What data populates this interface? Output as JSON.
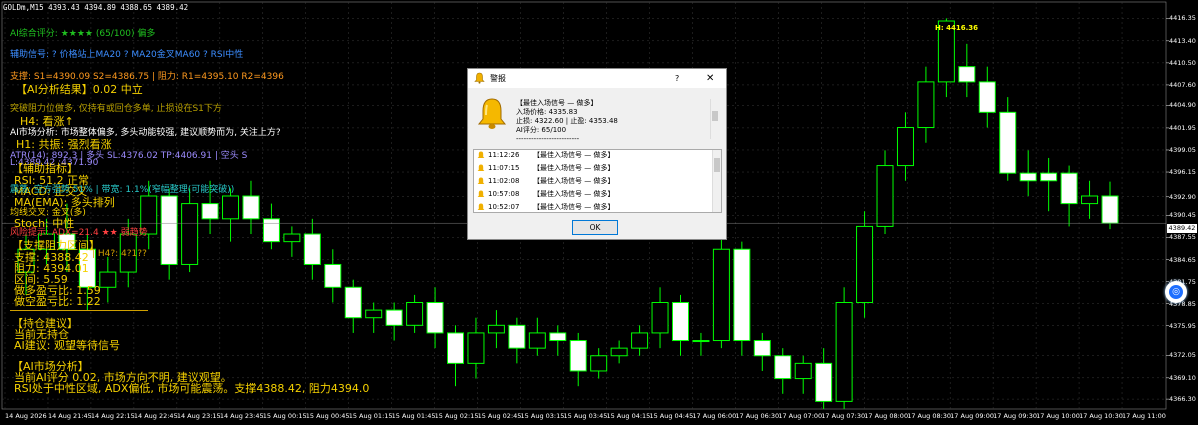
{
  "header": {
    "symbol_line": "GOLDm,M15  4393.43 4394.89 4388.65 4389.42"
  },
  "colors": {
    "bull": "#00ff00",
    "bear_body": "#ffffff",
    "grid": "#3a3a3a",
    "gold_text": "#f5d100",
    "blue_text": "#3c8dff",
    "orange_text": "#ff9a1f",
    "purple_text": "#9d8cff",
    "cyan_text": "#28c8c8",
    "red_text": "#ff4040",
    "green_text": "#20c020"
  },
  "overlay": {
    "ai_score": "AI综合评分: ★★★★ (65/100) 偏多",
    "aux_signal": "辅助信号: ? 价格站上MA20 ? MA20金叉MA60 ? RSI中性",
    "support_line": "支撑: S1=4390.09 S2=4386.75 | 阻力: R1=4395.10 R2=4396",
    "ai_overview_title": "【AI分析结果】0.02 中立",
    "suggest_line": "突破阻力位做多, 仅持有或回仓多单, 止损设在S1下方",
    "timeframe_h4": "H4: 看涨↑",
    "ai_view": "AI市场分析: 市场整体偏多, 多头动能较强, 建议顺势而为, 关注上方?",
    "h1_status": "H1: 共振: 强烈看涨",
    "atr_line": "ATR(14): 892.3 | 多头 SL:4376.02  TP:4406.91 | 空头 S",
    "l_line": "L:4389.42    :4371.90",
    "aux_title": "【辅助指标】",
    "rsi": "RSI: 51.2 正常",
    "macd": "MACD: 正交叉",
    "macd_extra": "震荡: 空方强势 51% | 带宽: 1.1%(窄幅整理(可能突破))",
    "ma_line": "MA(EMA): 多头排列",
    "ma_extra": "均线交叉: 金叉(多)",
    "stoch": "Stoch: 中性",
    "risk": "风险提示: ADX=21.4 ★★ 弱趋势",
    "sr_title": "【支撑阻力区间】",
    "sr_s": "支撑: 4388.42",
    "sr_s_extra": "| H4?: 4?1??",
    "sr_r": "阻力: 4394.01",
    "sr_range": "区间: 5.59",
    "long_ratio": "做多盈亏比: 1.59",
    "short_ratio": "做空盈亏比: 1.22",
    "pos_title": "【持仓建议】",
    "pos_none": "当前无持仓",
    "pos_ai": "AI建议: 观望等待信号",
    "market_title": "【AI市场分析】",
    "market_l1": "当前AI评分 0.02, 市场方向不明, 建议观望。",
    "market_l2": "RSI处于中性区域, ADX偏低, 市场可能震荡。支撑4388.42, 阻力4394.0"
  },
  "price_axis": {
    "labels": [
      "4416.35",
      "4413.40",
      "4410.50",
      "4407.60",
      "4404.90",
      "4401.95",
      "4399.05",
      "4396.15",
      "4392.90",
      "4390.45",
      "4387.55",
      "4384.65",
      "4381.75",
      "4378.85",
      "4375.95",
      "4372.05",
      "4369.10",
      "4366.30"
    ],
    "current_price": "4389.42",
    "high_marker": "H: 4416.36"
  },
  "time_axis": {
    "labels": [
      "14 Aug 2026",
      "14 Aug 21:45",
      "14 Aug 22:15",
      "14 Aug 22:45",
      "14 Aug 23:15",
      "14 Aug 23:45",
      "15 Aug 00:15",
      "15 Aug 00:45",
      "15 Aug 01:15",
      "15 Aug 01:45",
      "15 Aug 02:15",
      "15 Aug 02:45",
      "15 Aug 03:15",
      "15 Aug 03:45",
      "15 Aug 04:15",
      "15 Aug 04:45",
      "17 Aug 06:00",
      "17 Aug 06:30",
      "17 Aug 07:00",
      "17 Aug 07:30",
      "17 Aug 08:00",
      "17 Aug 08:30",
      "17 Aug 09:00",
      "17 Aug 09:30",
      "17 Aug 10:00",
      "17 Aug 10:30",
      "17 Aug 11:00"
    ]
  },
  "candles": [
    {
      "o": 4383,
      "c": 4386,
      "h": 4388,
      "l": 4380
    },
    {
      "o": 4386,
      "c": 4388,
      "h": 4390,
      "l": 4384
    },
    {
      "o": 4388,
      "c": 4386,
      "h": 4392,
      "l": 4383
    },
    {
      "o": 4386,
      "c": 4381,
      "h": 4388,
      "l": 4378
    },
    {
      "o": 4381,
      "c": 4383,
      "h": 4385,
      "l": 4379
    },
    {
      "o": 4383,
      "c": 4388,
      "h": 4390,
      "l": 4381
    },
    {
      "o": 4388,
      "c": 4393,
      "h": 4395,
      "l": 4386
    },
    {
      "o": 4393,
      "c": 4384,
      "h": 4394,
      "l": 4382
    },
    {
      "o": 4384,
      "c": 4392,
      "h": 4394,
      "l": 4383
    },
    {
      "o": 4392,
      "c": 4390,
      "h": 4395,
      "l": 4388
    },
    {
      "o": 4390,
      "c": 4393,
      "h": 4394,
      "l": 4387
    },
    {
      "o": 4393,
      "c": 4390,
      "h": 4395,
      "l": 4388
    },
    {
      "o": 4390,
      "c": 4387,
      "h": 4392,
      "l": 4386
    },
    {
      "o": 4387,
      "c": 4388,
      "h": 4389,
      "l": 4385
    },
    {
      "o": 4388,
      "c": 4384,
      "h": 4390,
      "l": 4382
    },
    {
      "o": 4384,
      "c": 4381,
      "h": 4386,
      "l": 4379
    },
    {
      "o": 4381,
      "c": 4377,
      "h": 4382,
      "l": 4375
    },
    {
      "o": 4377,
      "c": 4378,
      "h": 4379,
      "l": 4375
    },
    {
      "o": 4378,
      "c": 4376,
      "h": 4379,
      "l": 4374
    },
    {
      "o": 4376,
      "c": 4379,
      "h": 4380,
      "l": 4375
    },
    {
      "o": 4379,
      "c": 4375,
      "h": 4381,
      "l": 4373
    },
    {
      "o": 4375,
      "c": 4371,
      "h": 4376,
      "l": 4368
    },
    {
      "o": 4371,
      "c": 4375,
      "h": 4377,
      "l": 4369
    },
    {
      "o": 4375,
      "c": 4376,
      "h": 4378,
      "l": 4373
    },
    {
      "o": 4376,
      "c": 4373,
      "h": 4377,
      "l": 4371
    },
    {
      "o": 4373,
      "c": 4375,
      "h": 4377,
      "l": 4372
    },
    {
      "o": 4375,
      "c": 4374,
      "h": 4376,
      "l": 4372
    },
    {
      "o": 4374,
      "c": 4370,
      "h": 4375,
      "l": 4368
    },
    {
      "o": 4370,
      "c": 4372,
      "h": 4373,
      "l": 4369
    },
    {
      "o": 4372,
      "c": 4373,
      "h": 4374,
      "l": 4371
    },
    {
      "o": 4373,
      "c": 4375,
      "h": 4376,
      "l": 4372
    },
    {
      "o": 4375,
      "c": 4379,
      "h": 4381,
      "l": 4373
    },
    {
      "o": 4379,
      "c": 4374,
      "h": 4380,
      "l": 4372
    },
    {
      "o": 4374,
      "c": 4374,
      "h": 4375,
      "l": 4372
    },
    {
      "o": 4374,
      "c": 4386,
      "h": 4388,
      "l": 4373
    },
    {
      "o": 4386,
      "c": 4374,
      "h": 4387,
      "l": 4372
    },
    {
      "o": 4374,
      "c": 4372,
      "h": 4375,
      "l": 4370
    },
    {
      "o": 4372,
      "c": 4369,
      "h": 4373,
      "l": 4367
    },
    {
      "o": 4369,
      "c": 4371,
      "h": 4372,
      "l": 4367
    },
    {
      "o": 4371,
      "c": 4366,
      "h": 4373,
      "l": 4365
    },
    {
      "o": 4366,
      "c": 4379,
      "h": 4381,
      "l": 4365
    },
    {
      "o": 4379,
      "c": 4389,
      "h": 4391,
      "l": 4377
    },
    {
      "o": 4389,
      "c": 4397,
      "h": 4399,
      "l": 4388
    },
    {
      "o": 4397,
      "c": 4402,
      "h": 4404,
      "l": 4395
    },
    {
      "o": 4402,
      "c": 4408,
      "h": 4410,
      "l": 4400
    },
    {
      "o": 4408,
      "c": 4416,
      "h": 4416.35,
      "l": 4406
    },
    {
      "o": 4410,
      "c": 4408,
      "h": 4413,
      "l": 4406
    },
    {
      "o": 4408,
      "c": 4404,
      "h": 4410,
      "l": 4402
    },
    {
      "o": 4404,
      "c": 4396,
      "h": 4406,
      "l": 4395
    },
    {
      "o": 4396,
      "c": 4395,
      "h": 4399,
      "l": 4393
    },
    {
      "o": 4396,
      "c": 4395,
      "h": 4398,
      "l": 4391
    },
    {
      "o": 4396,
      "c": 4392,
      "h": 4397,
      "l": 4389
    },
    {
      "o": 4392,
      "c": 4393,
      "h": 4395,
      "l": 4390
    },
    {
      "o": 4393,
      "c": 4389.42,
      "h": 4394.89,
      "l": 4388.65
    }
  ],
  "dialog": {
    "title": "警报",
    "help": "?",
    "close": "✕",
    "msg_title": "【最佳入场信号 — 做多】",
    "msg_entry": "入场价格: 4335.83",
    "msg_sl_tp": "止损: 4322.60 | 止盈: 4353.48",
    "msg_score": "AI评分: 65/100",
    "msg_dash": "-------------------------",
    "rows": [
      {
        "time": "11:12:26",
        "msg": "【最佳入场信号 — 做多】"
      },
      {
        "time": "11:07:15",
        "msg": "【最佳入场信号 — 做多】"
      },
      {
        "time": "11:02:08",
        "msg": "【最佳入场信号 — 做多】"
      },
      {
        "time": "10:57:08",
        "msg": "【最佳入场信号 — 做多】"
      },
      {
        "time": "10:52:07",
        "msg": "【最佳入场信号 — 做多】"
      }
    ],
    "ok": "OK"
  }
}
